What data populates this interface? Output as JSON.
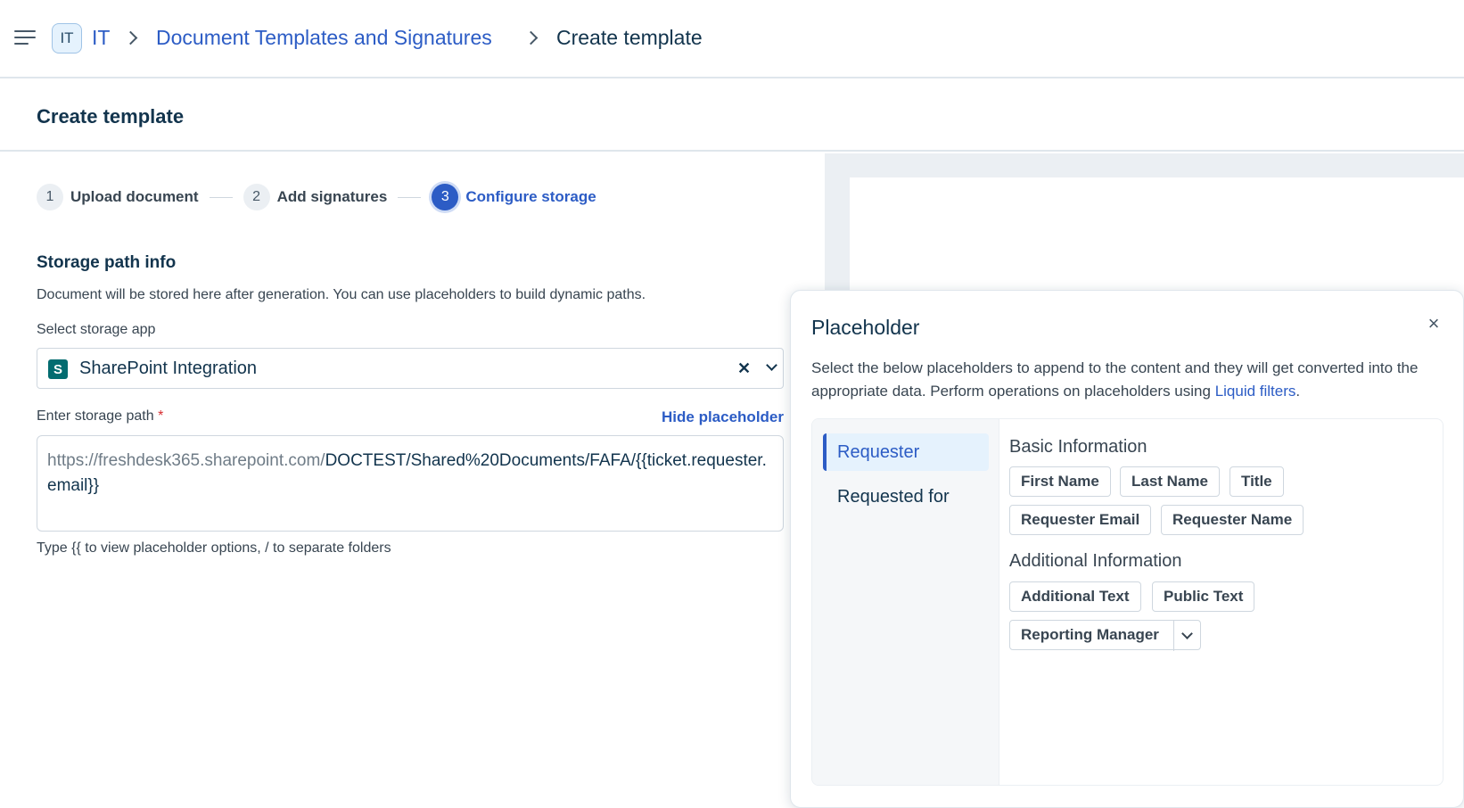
{
  "topbar": {
    "workspace_badge": "IT",
    "breadcrumb": {
      "workspace": "IT",
      "section": "Document Templates and Signatures",
      "current": "Create template"
    }
  },
  "page": {
    "title": "Create template"
  },
  "stepper": {
    "steps": [
      {
        "number": "1",
        "label": "Upload document"
      },
      {
        "number": "2",
        "label": "Add signatures"
      },
      {
        "number": "3",
        "label": "Configure storage"
      }
    ],
    "active_step": 3
  },
  "storage": {
    "title": "Storage path info",
    "description": "Document will be stored here after generation. You can use placeholders to build dynamic paths.",
    "app_label": "Select storage app",
    "app_icon_letter": "S",
    "app_value": "SharePoint Integration",
    "path_label": "Enter storage path",
    "required_mark": "*",
    "hide_placeholder": "Hide placeholder",
    "path_prefix": "https://freshdesk365.sharepoint.com/",
    "path_value": "DOCTEST/Shared%20Documents/FAFA/{{ticket.requester.email}}",
    "hint": "Type {{ to view placeholder options, / to separate folders"
  },
  "placeholder_panel": {
    "title": "Placeholder",
    "close_icon": "×",
    "description": "Select the below placeholders to append to the content and they will get converted into the appropriate data. Perform operations on placeholders using",
    "link_text": "Liquid filters",
    "link_suffix": ".",
    "tabs": [
      {
        "label": "Requester",
        "active": true
      },
      {
        "label": "Requested for",
        "active": false
      }
    ],
    "groups": [
      {
        "title": "Basic Information",
        "chips": [
          "First Name",
          "Last Name",
          "Title",
          "Requester Email",
          "Requester Name"
        ]
      },
      {
        "title": "Additional Information",
        "chips": [
          "Additional Text",
          "Public Text",
          "Reporting Manager"
        ]
      }
    ]
  },
  "colors": {
    "accent": "#2c5cc5",
    "sharepoint": "#036c70",
    "required": "#d72d30",
    "panel_bg": "#ebeff3"
  }
}
